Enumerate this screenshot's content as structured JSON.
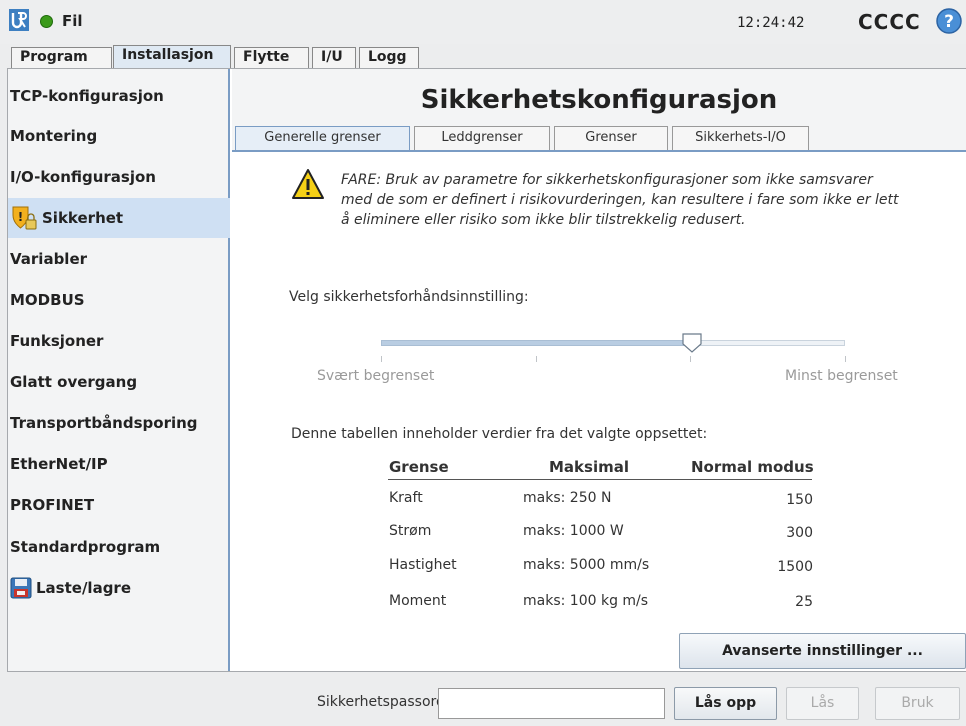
{
  "topbar": {
    "file_menu": "Fil",
    "time": "12:24:42",
    "robot_name": "CCCC"
  },
  "main_tabs": [
    {
      "label": "Program"
    },
    {
      "label": "Installasjon"
    },
    {
      "label": "Flytte"
    },
    {
      "label": "I/U"
    },
    {
      "label": "Logg"
    }
  ],
  "sidebar": {
    "items": [
      {
        "label": "TCP-konfigurasjon"
      },
      {
        "label": "Montering"
      },
      {
        "label": "I/O-konfigurasjon"
      },
      {
        "label": "Sikkerhet"
      },
      {
        "label": "Variabler"
      },
      {
        "label": "MODBUS"
      },
      {
        "label": "Funksjoner"
      },
      {
        "label": "Glatt overgang"
      },
      {
        "label": "Transportbåndsporing"
      },
      {
        "label": "EtherNet/IP"
      },
      {
        "label": "PROFINET"
      },
      {
        "label": "Standardprogram"
      },
      {
        "label": "Laste/lagre"
      }
    ]
  },
  "main": {
    "title": "Sikkerhetskonfigurasjon",
    "subtabs": [
      {
        "label": "Generelle grenser"
      },
      {
        "label": "Leddgrenser"
      },
      {
        "label": "Grenser"
      },
      {
        "label": "Sikkerhets-I/O"
      }
    ],
    "warning": "FARE: Bruk av parametre for sikkerhetskonfigurasjoner som ikke samsvarer med de som er definert i risikovurderingen, kan resultere i fare som ikke er lett å eliminere eller risiko som ikke blir tilstrekkelig redusert.",
    "preset_label": "Velg sikkerhetsforhåndsinnstilling:",
    "slider": {
      "min_label": "Svært begrenset",
      "max_label": "Minst begrenset",
      "value_fraction": 0.67
    },
    "table_caption": "Denne tabellen inneholder verdier fra det valgte oppsettet:",
    "table": {
      "headers": [
        "Grense",
        "Maksimal",
        "Normal modus"
      ],
      "rows": [
        {
          "name": "Kraft",
          "max": "maks: 250 N",
          "normal": "150"
        },
        {
          "name": "Strøm",
          "max": "maks: 1000 W",
          "normal": "300"
        },
        {
          "name": "Hastighet",
          "max": "maks: 5000 mm/s",
          "normal": "1500"
        },
        {
          "name": "Moment",
          "max": "maks: 100 kg m/s",
          "normal": "25"
        }
      ]
    },
    "advanced_button": "Avanserte innstillinger ..."
  },
  "footer": {
    "password_label": "Sikkerhetspassord",
    "password_value": "",
    "unlock_button": "Lås opp",
    "lock_button": "Lås",
    "apply_button": "Bruk"
  },
  "colors": {
    "accent_blue": "#7a9cc4",
    "selected_bg": "#cfe0f3",
    "run_green": "#3b9a1a"
  }
}
